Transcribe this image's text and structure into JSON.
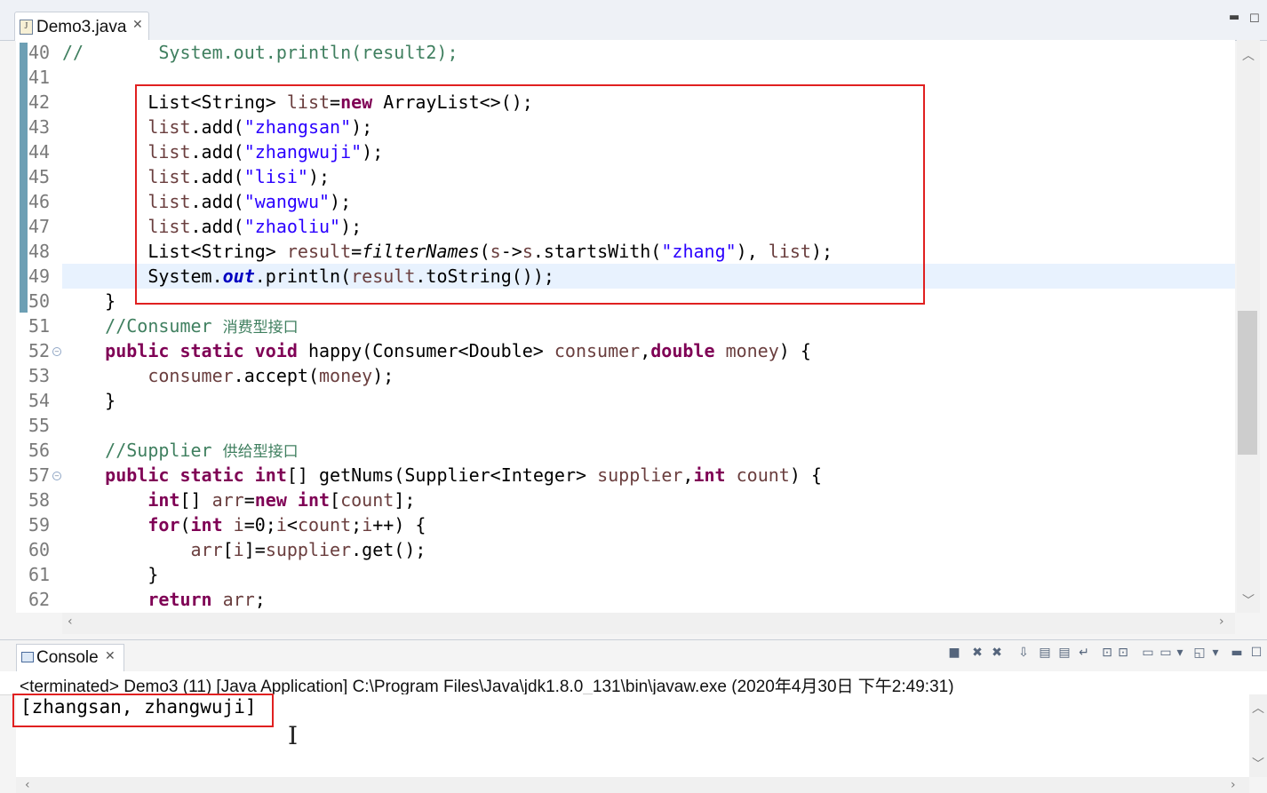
{
  "editor": {
    "tab_label": "Demo3.java",
    "tab_close": "✕",
    "lines": [
      {
        "num": "40",
        "segments": [
          {
            "c": "cm",
            "t": "//       System.out.println(result2);"
          }
        ]
      },
      {
        "num": "41",
        "segments": []
      },
      {
        "num": "42",
        "segments": [
          {
            "c": "",
            "t": "        List<String> "
          },
          {
            "c": "var",
            "t": "list"
          },
          {
            "c": "",
            "t": "="
          },
          {
            "c": "kw",
            "t": "new"
          },
          {
            "c": "",
            "t": " ArrayList<>();"
          }
        ]
      },
      {
        "num": "43",
        "segments": [
          {
            "c": "var",
            "t": "        list"
          },
          {
            "c": "",
            "t": ".add("
          },
          {
            "c": "st",
            "t": "\"zhangsan\""
          },
          {
            "c": "",
            "t": ");"
          }
        ]
      },
      {
        "num": "44",
        "segments": [
          {
            "c": "var",
            "t": "        list"
          },
          {
            "c": "",
            "t": ".add("
          },
          {
            "c": "st",
            "t": "\"zhangwuji\""
          },
          {
            "c": "",
            "t": ");"
          }
        ]
      },
      {
        "num": "45",
        "segments": [
          {
            "c": "var",
            "t": "        list"
          },
          {
            "c": "",
            "t": ".add("
          },
          {
            "c": "st",
            "t": "\"lisi\""
          },
          {
            "c": "",
            "t": ");"
          }
        ]
      },
      {
        "num": "46",
        "segments": [
          {
            "c": "var",
            "t": "        list"
          },
          {
            "c": "",
            "t": ".add("
          },
          {
            "c": "st",
            "t": "\"wangwu\""
          },
          {
            "c": "",
            "t": ");"
          }
        ]
      },
      {
        "num": "47",
        "segments": [
          {
            "c": "var",
            "t": "        list"
          },
          {
            "c": "",
            "t": ".add("
          },
          {
            "c": "st",
            "t": "\"zhaoliu\""
          },
          {
            "c": "",
            "t": ");"
          }
        ]
      },
      {
        "num": "48",
        "segments": [
          {
            "c": "",
            "t": "        List<String> "
          },
          {
            "c": "var",
            "t": "result"
          },
          {
            "c": "",
            "t": "="
          },
          {
            "c": "ital",
            "t": "filterNames"
          },
          {
            "c": "",
            "t": "("
          },
          {
            "c": "var",
            "t": "s"
          },
          {
            "c": "",
            "t": "->"
          },
          {
            "c": "var",
            "t": "s"
          },
          {
            "c": "",
            "t": ".startsWith("
          },
          {
            "c": "st",
            "t": "\"zhang\""
          },
          {
            "c": "",
            "t": "), "
          },
          {
            "c": "var",
            "t": "list"
          },
          {
            "c": "",
            "t": ");"
          }
        ]
      },
      {
        "num": "49",
        "segments": [
          {
            "c": "",
            "t": "        System."
          },
          {
            "c": "fld",
            "t": "out"
          },
          {
            "c": "",
            "t": ".println("
          },
          {
            "c": "var",
            "t": "result"
          },
          {
            "c": "",
            "t": ".toString());"
          }
        ]
      },
      {
        "num": "50",
        "segments": [
          {
            "c": "",
            "t": "    }"
          }
        ]
      },
      {
        "num": "51",
        "segments": [
          {
            "c": "cm",
            "t": "    //Consumer "
          },
          {
            "c": "cjk",
            "t": "消费型接口"
          }
        ]
      },
      {
        "num": "52",
        "fold": true,
        "segments": [
          {
            "c": "kw",
            "t": "    public static void"
          },
          {
            "c": "",
            "t": " happy(Consumer<Double> "
          },
          {
            "c": "var",
            "t": "consumer"
          },
          {
            "c": "",
            "t": ","
          },
          {
            "c": "kw",
            "t": "double"
          },
          {
            "c": "",
            "t": " "
          },
          {
            "c": "var",
            "t": "money"
          },
          {
            "c": "",
            "t": ") {"
          }
        ]
      },
      {
        "num": "53",
        "segments": [
          {
            "c": "var",
            "t": "        consumer"
          },
          {
            "c": "",
            "t": ".accept("
          },
          {
            "c": "var",
            "t": "money"
          },
          {
            "c": "",
            "t": ");"
          }
        ]
      },
      {
        "num": "54",
        "segments": [
          {
            "c": "",
            "t": "    }"
          }
        ]
      },
      {
        "num": "55",
        "segments": []
      },
      {
        "num": "56",
        "segments": [
          {
            "c": "cm",
            "t": "    //Supplier "
          },
          {
            "c": "cjk",
            "t": "供给型接口"
          }
        ]
      },
      {
        "num": "57",
        "fold": true,
        "segments": [
          {
            "c": "kw",
            "t": "    public static int"
          },
          {
            "c": "",
            "t": "[] getNums(Supplier<Integer> "
          },
          {
            "c": "var",
            "t": "supplier"
          },
          {
            "c": "",
            "t": ","
          },
          {
            "c": "kw",
            "t": "int"
          },
          {
            "c": "",
            "t": " "
          },
          {
            "c": "var",
            "t": "count"
          },
          {
            "c": "",
            "t": ") {"
          }
        ]
      },
      {
        "num": "58",
        "segments": [
          {
            "c": "kw",
            "t": "        int"
          },
          {
            "c": "",
            "t": "[] "
          },
          {
            "c": "var",
            "t": "arr"
          },
          {
            "c": "",
            "t": "="
          },
          {
            "c": "kw",
            "t": "new int"
          },
          {
            "c": "",
            "t": "["
          },
          {
            "c": "var",
            "t": "count"
          },
          {
            "c": "",
            "t": "];"
          }
        ]
      },
      {
        "num": "59",
        "segments": [
          {
            "c": "kw",
            "t": "        for"
          },
          {
            "c": "",
            "t": "("
          },
          {
            "c": "kw",
            "t": "int"
          },
          {
            "c": "",
            "t": " "
          },
          {
            "c": "var",
            "t": "i"
          },
          {
            "c": "",
            "t": "=0;"
          },
          {
            "c": "var",
            "t": "i"
          },
          {
            "c": "",
            "t": "<"
          },
          {
            "c": "var",
            "t": "count"
          },
          {
            "c": "",
            "t": ";"
          },
          {
            "c": "var",
            "t": "i"
          },
          {
            "c": "",
            "t": "++) {"
          }
        ]
      },
      {
        "num": "60",
        "segments": [
          {
            "c": "var",
            "t": "            arr"
          },
          {
            "c": "",
            "t": "["
          },
          {
            "c": "var",
            "t": "i"
          },
          {
            "c": "",
            "t": "]="
          },
          {
            "c": "var",
            "t": "supplier"
          },
          {
            "c": "",
            "t": ".get();"
          }
        ]
      },
      {
        "num": "61",
        "segments": [
          {
            "c": "",
            "t": "        }"
          }
        ]
      },
      {
        "num": "62",
        "segments": [
          {
            "c": "kw",
            "t": "        return"
          },
          {
            "c": "",
            "t": " "
          },
          {
            "c": "var",
            "t": "arr"
          },
          {
            "c": "",
            "t": ";"
          }
        ]
      }
    ]
  },
  "console": {
    "tab_label": "Console",
    "tab_close": "✕",
    "info": "<terminated> Demo3 (11) [Java Application] C:\\Program Files\\Java\\jdk1.8.0_131\\bin\\javaw.exe (2020年4月30日 下午2:49:31)",
    "output": "[zhangsan, zhangwuji]",
    "toolbar_icons": [
      "terminate-icon",
      "remove-launch-icon",
      "remove-all-terminated-icon",
      "scroll-lock-icon",
      "show-when-stdout-icon",
      "show-when-stderr-icon",
      "word-wrap-icon",
      "pin-console-icon",
      "pin-console-active-icon",
      "open-console-icon",
      "display-console-icon",
      "display-console-dropdown-icon",
      "new-console-icon",
      "new-console-dropdown-icon"
    ]
  },
  "colors": {
    "highlight_box": "#e02020",
    "keyword": "#7f0055",
    "string": "#2a00ff",
    "comment": "#3f7f5f"
  }
}
